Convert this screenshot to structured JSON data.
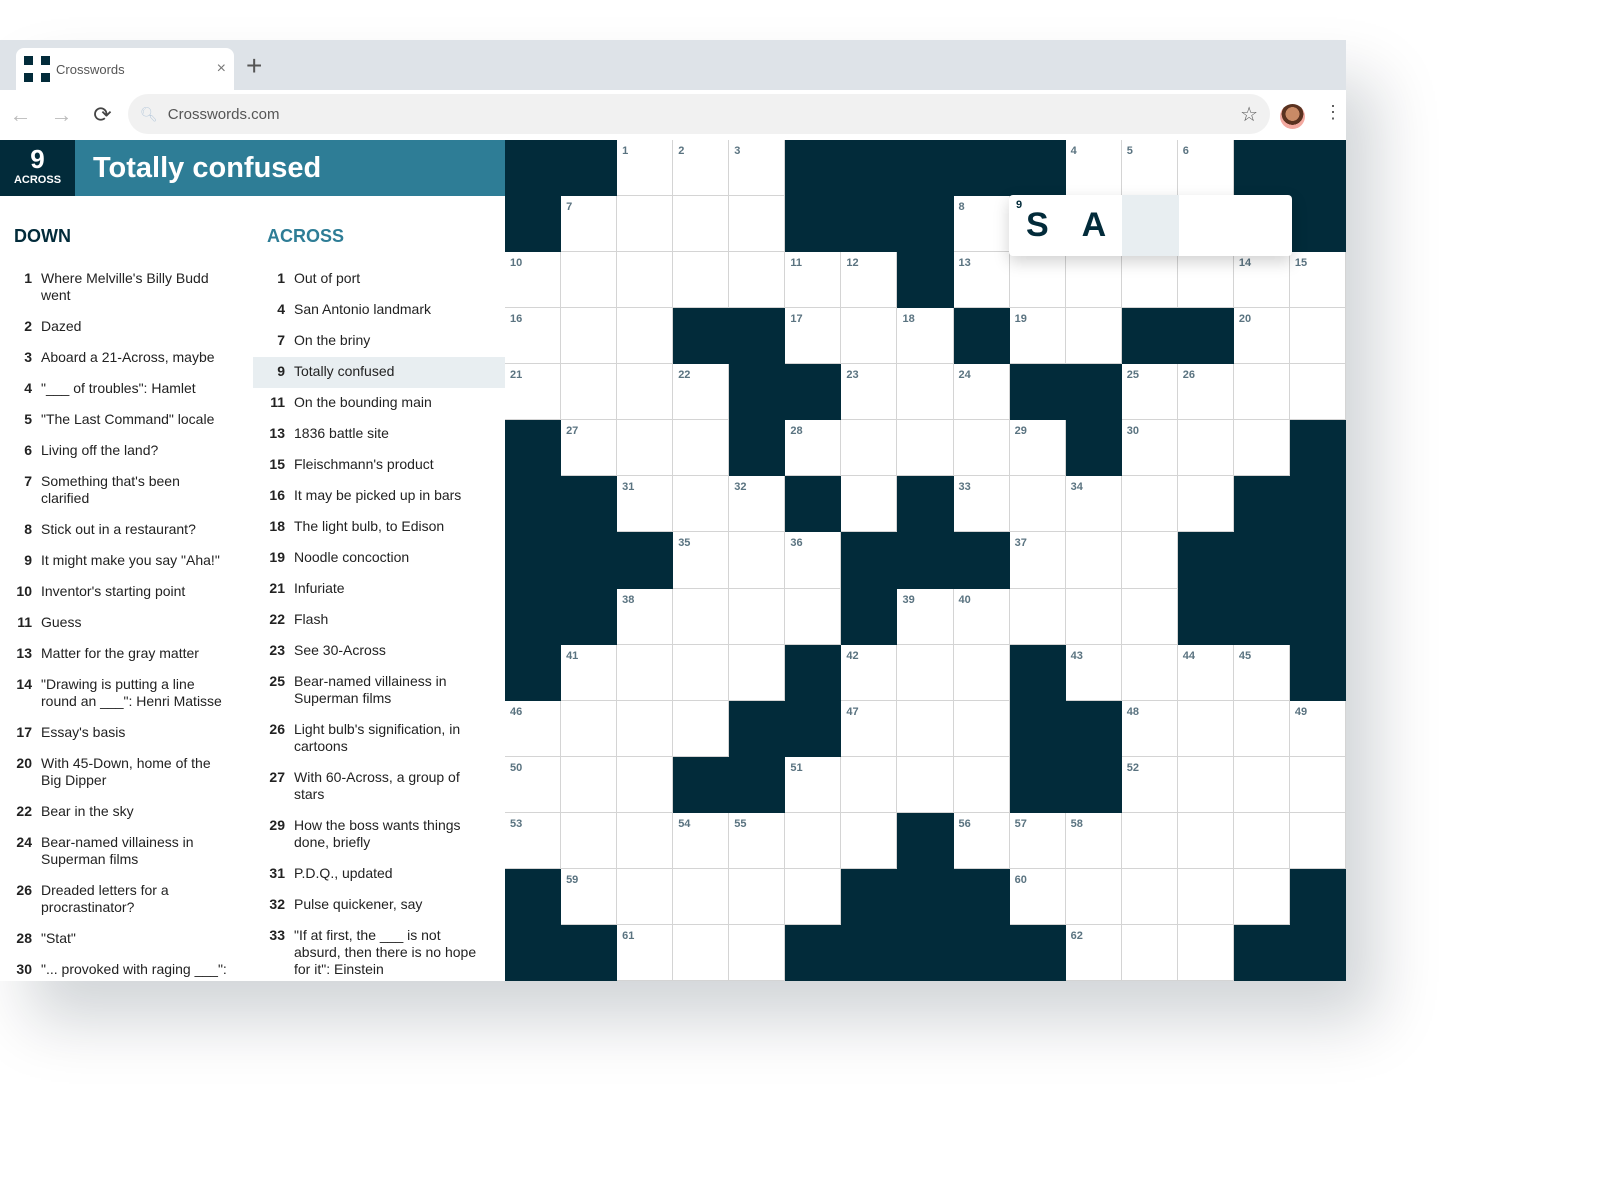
{
  "browser": {
    "tab_title": "Crosswords",
    "url": "Crosswords.com",
    "icons": [
      "crossword-favicon",
      "close-icon",
      "plus-icon",
      "back-arrow-icon",
      "forward-arrow-icon",
      "reload-icon",
      "search-icon",
      "star-icon",
      "avatar",
      "kebab-menu-icon"
    ]
  },
  "current_clue": {
    "number": "9",
    "direction": "ACROSS",
    "text": "Totally confused"
  },
  "colors": {
    "dark": "#022b3a",
    "accent": "#2e7d96",
    "highlight": "#e8eef1"
  },
  "down": {
    "heading": "DOWN",
    "clues": [
      {
        "n": "1",
        "t": "Where Melville's Billy Budd went"
      },
      {
        "n": "2",
        "t": "Dazed"
      },
      {
        "n": "3",
        "t": "Aboard a 21-Across, maybe"
      },
      {
        "n": "4",
        "t": "\"___ of troubles\": Hamlet"
      },
      {
        "n": "5",
        "t": "\"The Last Command\" locale"
      },
      {
        "n": "6",
        "t": "Living off the land?"
      },
      {
        "n": "7",
        "t": "Something that's been clarified"
      },
      {
        "n": "8",
        "t": "Stick out in a restaurant?"
      },
      {
        "n": "9",
        "t": "It might make you say \"Aha!\""
      },
      {
        "n": "10",
        "t": "Inventor's starting point"
      },
      {
        "n": "11",
        "t": "Guess"
      },
      {
        "n": "13",
        "t": "Matter for the gray matter"
      },
      {
        "n": "14",
        "t": "\"Drawing is putting a line round an ___\": Henri Matisse"
      },
      {
        "n": "17",
        "t": "Essay's basis"
      },
      {
        "n": "20",
        "t": "With 45-Down, home of the Big Dipper"
      },
      {
        "n": "22",
        "t": "Bear in the sky"
      },
      {
        "n": "24",
        "t": "Bear-named villainess in Superman films"
      },
      {
        "n": "26",
        "t": "Dreaded letters for a procrastinator?"
      },
      {
        "n": "28",
        "t": "\"Stat\""
      },
      {
        "n": "30",
        "t": "\"... provoked with raging ___\":"
      }
    ]
  },
  "across": {
    "heading": "ACROSS",
    "active_index": 3,
    "clues": [
      {
        "n": "1",
        "t": "Out of port"
      },
      {
        "n": "4",
        "t": "San Antonio landmark"
      },
      {
        "n": "7",
        "t": "On the briny"
      },
      {
        "n": "9",
        "t": "Totally confused"
      },
      {
        "n": "11",
        "t": "On the bounding main"
      },
      {
        "n": "13",
        "t": "1836 battle site"
      },
      {
        "n": "15",
        "t": "Fleischmann's product"
      },
      {
        "n": "16",
        "t": "It may be picked up in bars"
      },
      {
        "n": "18",
        "t": "The light bulb, to Edison"
      },
      {
        "n": "19",
        "t": "Noodle concoction"
      },
      {
        "n": "21",
        "t": "Infuriate"
      },
      {
        "n": "22",
        "t": "Flash"
      },
      {
        "n": "23",
        "t": "See 30-Across"
      },
      {
        "n": "25",
        "t": "Bear-named villainess in Superman films"
      },
      {
        "n": "26",
        "t": "Light bulb's signification, in cartoons"
      },
      {
        "n": "27",
        "t": "With 60-Across, a group of stars"
      },
      {
        "n": "29",
        "t": "How the boss wants things done, briefly"
      },
      {
        "n": "31",
        "t": "P.D.Q., updated"
      },
      {
        "n": "32",
        "t": "Pulse quickener, say"
      },
      {
        "n": "33",
        "t": "\"If at first, the ___ is not absurd, then there is no hope for it\": Einstein"
      }
    ]
  },
  "grid": {
    "rows": [
      "##...#####...##",
      "#....###.....##",
      ".......#.......",
      "...##...#..##..",
      "....##...##....",
      "#...#.....#...#",
      "##...#.#.....##",
      "###...###...###",
      "##....#.....###",
      "#....#...#....#",
      "....##...##....",
      "...##....##....",
      ".......#.......",
      "#.....###.....#",
      "##...#####...##"
    ]
  },
  "entry": {
    "number": "9",
    "letters": [
      "S",
      "A",
      "",
      "",
      ""
    ],
    "cursor": 2
  }
}
